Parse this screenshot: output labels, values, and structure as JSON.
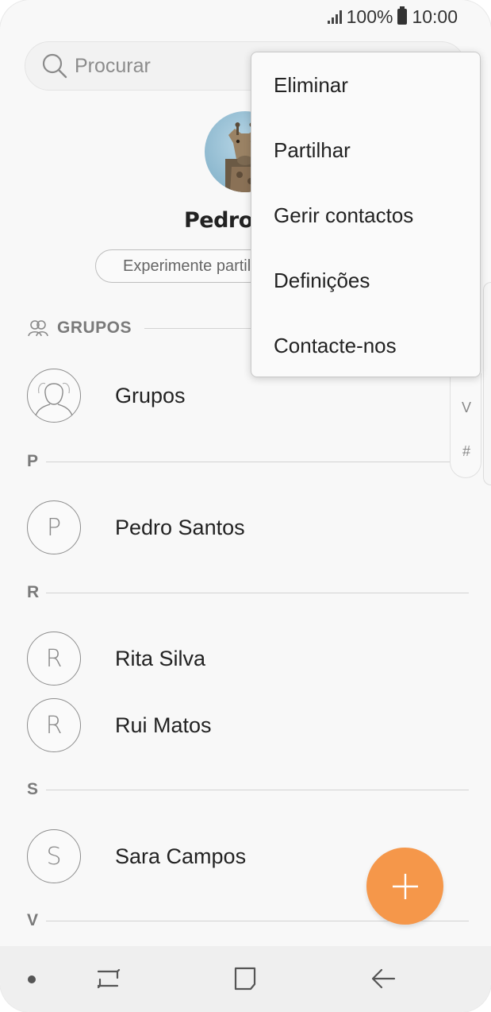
{
  "status_bar": {
    "battery": "100%",
    "time": "10:00"
  },
  "search": {
    "placeholder": "Procurar"
  },
  "profile": {
    "name": "Pedro S",
    "share_prompt": "Experimente partilhar"
  },
  "groups_section": {
    "header": "GRUPOS",
    "item": "Grupos"
  },
  "sections": [
    {
      "letter": "P",
      "contacts": [
        {
          "initial": "P",
          "name": "Pedro Santos"
        }
      ]
    },
    {
      "letter": "R",
      "contacts": [
        {
          "initial": "R",
          "name": "Rita Silva"
        },
        {
          "initial": "R",
          "name": "Rui Matos"
        }
      ]
    },
    {
      "letter": "S",
      "contacts": [
        {
          "initial": "S",
          "name": "Sara Campos"
        }
      ]
    },
    {
      "letter": "V",
      "contacts": []
    }
  ],
  "index_scroller": [
    "V",
    "#"
  ],
  "menu": {
    "items": [
      "Eliminar",
      "Partilhar",
      "Gerir contactos",
      "Definições",
      "Contacte-nos"
    ]
  },
  "fab": {
    "icon": "plus-icon",
    "color": "#f5974a"
  },
  "nav": {
    "icons": [
      "dot-icon",
      "recent-apps-icon",
      "home-icon",
      "back-icon"
    ]
  }
}
